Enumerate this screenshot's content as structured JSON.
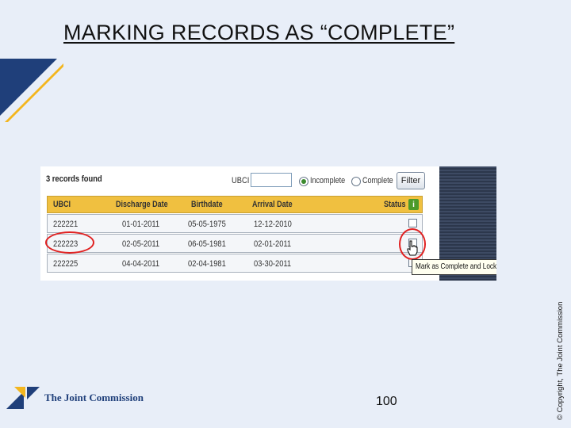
{
  "slide": {
    "title": "MARKING RECORDS AS “COMPLETE”",
    "page_number": "100",
    "copyright": "© Copyright, The Joint Commission",
    "logo_text": "The Joint Commission"
  },
  "app": {
    "records_found": "3 records found",
    "filter": {
      "ubci_label": "UBCI",
      "ubci_value": "",
      "radio_incomplete": "Incomplete",
      "radio_complete": "Complete",
      "selected": "Incomplete",
      "filter_button": "Filter"
    },
    "table": {
      "columns": [
        "UBCI",
        "Discharge Date",
        "Birthdate",
        "Arrival Date",
        "Status"
      ],
      "rows": [
        {
          "ubci": "222221",
          "discharge": "01-01-2011",
          "birth": "05-05-1975",
          "arrival": "12-12-2010"
        },
        {
          "ubci": "222223",
          "discharge": "02-05-2011",
          "birth": "06-05-1981",
          "arrival": "02-01-2011"
        },
        {
          "ubci": "222225",
          "discharge": "04-04-2011",
          "birth": "02-04-1981",
          "arrival": "03-30-2011"
        }
      ]
    },
    "tooltip": "Mark as Complete and Lock"
  },
  "colors": {
    "header_bg": "#f0c040",
    "highlight": "#e02020",
    "slide_bg": "#e8eef8",
    "brand_blue": "#1f3f7a",
    "brand_gold": "#f3b61f"
  },
  "icons": {
    "info": "info-icon",
    "cursor": "hand-pointer-icon"
  }
}
